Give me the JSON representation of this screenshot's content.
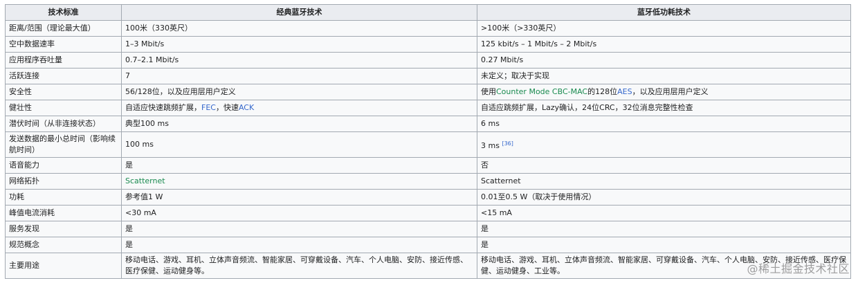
{
  "headers": [
    "技术标准",
    "经典蓝牙技术",
    "蓝牙低功耗技术"
  ],
  "rows": [
    {
      "label": "距离/范围（理论最大值）",
      "classic": "100米（330英尺）",
      "le": ">100米（>330英尺）"
    },
    {
      "label": "空中数据速率",
      "classic": "1–3 Mbit/s",
      "le": "125 kbit/s – 1 Mbit/s – 2 Mbit/s"
    },
    {
      "label": "应用程序吞吐量",
      "classic": "0.7–2.1 Mbit/s",
      "le": "0.27 Mbit/s"
    },
    {
      "label": "活跃连接",
      "classic": "7",
      "le": "未定义；取决于实现"
    },
    {
      "label": "安全性",
      "classic": "56/128位，以及应用层用户定义",
      "le_pre": "使用",
      "le_link1": "Counter Mode CBC-MAC",
      "le_mid": "的128位",
      "le_link2": "AES",
      "le_post": "，以及应用层用户定义"
    },
    {
      "label": "健壮性",
      "classic_pre": "自适应快速跳频扩展，",
      "classic_link1": "FEC",
      "classic_mid": "，快速",
      "classic_link2": "ACK",
      "le": "自适应跳频扩展，Lazy确认，24位CRC，32位消息完整性检查"
    },
    {
      "label": "潜伏时间（从非连接状态）",
      "classic": "典型100 ms",
      "le": "6 ms"
    },
    {
      "label": "发送数据的最小总时间（影响续航时间）",
      "classic": "100 ms",
      "le": "3 ms",
      "le_ref": "[36]"
    },
    {
      "label": "语音能力",
      "classic": "是",
      "le": "否"
    },
    {
      "label": "网络拓扑",
      "classic": "Scatternet",
      "le": "Scatternet"
    },
    {
      "label": "功耗",
      "classic": "参考值1 W",
      "le": "0.01至0.5 W（取决于使用情况）"
    },
    {
      "label": "峰值电流消耗",
      "classic": "<30 mA",
      "le": "<15 mA"
    },
    {
      "label": "服务发现",
      "classic": "是",
      "le": "是"
    },
    {
      "label": "规范概念",
      "classic": "是",
      "le": "是"
    },
    {
      "label": "主要用途",
      "classic": "移动电话、游戏、耳机、立体声音频流、智能家居、可穿戴设备、汽车、个人电脑、安防、接近传感、医疗保健、运动健身等。",
      "le": "移动电话、游戏、耳机、立体声音频流、智能家居、可穿戴设备、汽车、个人电脑、安防、接近传感、医疗保健、运动健身、工业等。"
    }
  ],
  "watermark": "@稀土掘金技术社区",
  "colors": {
    "header_bg": "#eaecf0",
    "cell_bg": "#f8f9fa",
    "border": "#a2a9b1",
    "link_blue": "#3366cc",
    "link_green": "#198a4f"
  }
}
